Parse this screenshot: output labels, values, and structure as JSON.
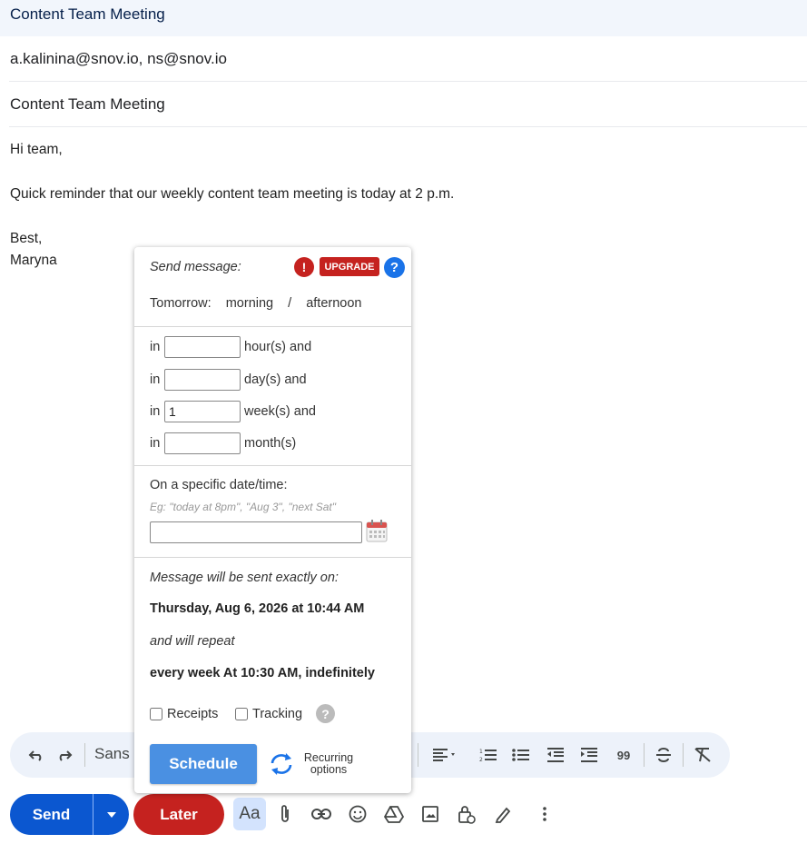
{
  "compose": {
    "window_title": "Content Team Meeting",
    "recipients": "a.kalinina@snov.io, ns@snov.io",
    "subject": "Content Team Meeting",
    "body_lines": [
      "Hi team,",
      "Quick reminder that our weekly content team meeting is today at 2 p.m.",
      "Best,",
      "Maryna"
    ]
  },
  "schedule_popup": {
    "send_message_label": "Send message:",
    "upgrade_label": "UPGRADE",
    "tomorrow_label": "Tomorrow:",
    "morning_label": "morning",
    "separator": "/",
    "afternoon_label": "afternoon",
    "in_label": "in",
    "relative_rows": [
      {
        "value": "",
        "unit": "hour(s) and"
      },
      {
        "value": "",
        "unit": "day(s) and"
      },
      {
        "value": "1",
        "unit": "week(s) and"
      },
      {
        "value": "",
        "unit": "month(s)"
      }
    ],
    "specific_label": "On a specific date/time:",
    "specific_placeholder": "Eg: \"today at 8pm\", \"Aug 3\", \"next Sat\"",
    "specific_value": "",
    "sent_exactly_label": "Message will be sent exactly on:",
    "sent_datetime": "Thursday, Aug 6, 2026 at 10:44 AM",
    "will_repeat_label": "and will repeat",
    "repeat_value": "every week At 10:30 AM, indefinitely",
    "receipts_label": "Receipts",
    "tracking_label": "Tracking",
    "schedule_button": "Schedule",
    "recurring_label_line1": "Recurring",
    "recurring_label_line2": "options"
  },
  "toolbar": {
    "font_label": "Sans"
  },
  "bottom_bar": {
    "send_label": "Send",
    "later_label": "Later",
    "format_label": "Aa"
  },
  "colors": {
    "send_blue": "#0b57d0",
    "later_red": "#c5221f",
    "schedule_blue": "#4a90e2",
    "upgrade_red": "#c5221f"
  }
}
